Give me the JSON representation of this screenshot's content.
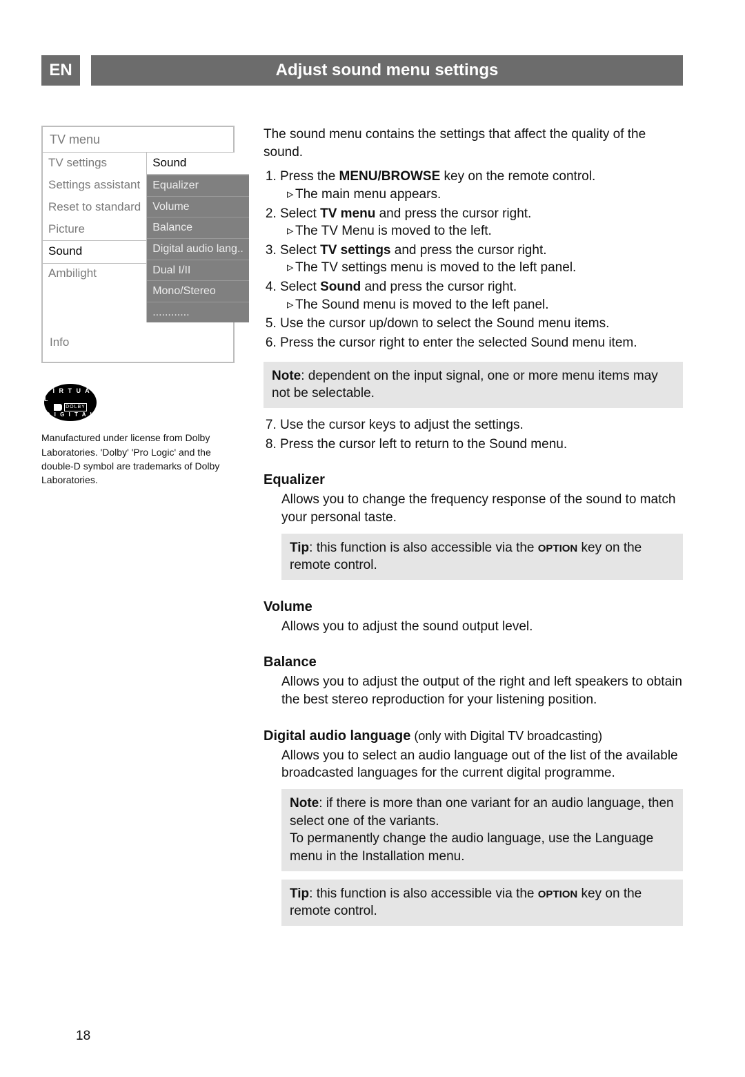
{
  "header": {
    "lang_badge": "EN",
    "title": "Adjust sound menu settings"
  },
  "menu": {
    "title": "TV menu",
    "left_items": [
      "TV settings",
      "Settings assistant",
      "Reset to standard",
      "Picture",
      "Sound",
      "Ambilight"
    ],
    "selected_index": 4,
    "right_head": "Sound",
    "right_items": [
      "Equalizer",
      "Volume",
      "Balance",
      "Digital audio lang..",
      "Dual I/II",
      "Mono/Stereo",
      "............"
    ],
    "footer": "Info"
  },
  "dolby": {
    "row1": "V I R T U A L",
    "row3": "D I G I T A L",
    "box": "DOLBY",
    "note": "Manufactured under license from Dolby Laboratories. 'Dolby' 'Pro Logic' and the double-D symbol are trademarks of Dolby Laboratories."
  },
  "intro": "The sound menu contains the settings that affect the quality of the sound.",
  "steps": {
    "s1": {
      "t": "Press the ",
      "b": "MENU/BROWSE",
      "t2": " key on the remote control.",
      "sub": "The main menu appears."
    },
    "s2": {
      "t": "Select ",
      "b": "TV menu",
      "t2": " and press the cursor right.",
      "sub": "The TV Menu is moved to the left."
    },
    "s3": {
      "t": "Select ",
      "b": "TV settings",
      "t2": " and press the cursor right.",
      "sub": "The TV settings menu is moved to the left panel."
    },
    "s4": {
      "t": "Select ",
      "b": "Sound",
      "t2": " and press the cursor right.",
      "sub": "The Sound menu is moved to the left panel."
    },
    "s5": {
      "t": "Use the cursor up/down to select the Sound menu items."
    },
    "s6": {
      "t": "Press the cursor right to enter the selected Sound menu item."
    }
  },
  "note1_b": "Note",
  "note1": ": dependent on the input signal, one or more menu items may not be selectable.",
  "steps2": {
    "s7": "Use the cursor keys to adjust the settings.",
    "s8": "Press the cursor left to return to the Sound menu."
  },
  "sections": {
    "equalizer": {
      "heading": "Equalizer",
      "body": "Allows you to change the frequency response of the sound to match your personal taste.",
      "tip_b": "Tip",
      "tip": ": this function is also accessible via the ",
      "tip_key": "OPTION",
      "tip_tail": " key on the remote control."
    },
    "volume": {
      "heading": "Volume",
      "body": "Allows you to adjust the sound output level."
    },
    "balance": {
      "heading": "Balance",
      "body": "Allows you to adjust the output of the right and left speakers to obtain the best stereo reproduction for your listening position."
    },
    "dal": {
      "heading": "Digital audio language",
      "qualifier": " (only with Digital TV broadcasting)",
      "body": "Allows you to select an audio language out of the list of the available broadcasted languages for the current digital programme.",
      "note_b": "Note",
      "note": ": if there is more than one variant for an audio language, then select one of the variants.\nTo permanently change the audio language, use the Language menu in the Installation menu.",
      "tip_b": "Tip",
      "tip": ": this function is also accessible via the ",
      "tip_key": "OPTION",
      "tip_tail": " key on the remote control."
    }
  },
  "page_number": "18"
}
